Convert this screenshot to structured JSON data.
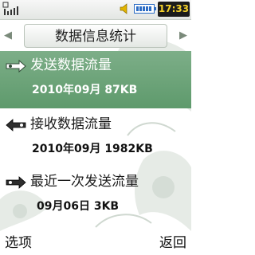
{
  "status_bar": {
    "time": "17:33",
    "icons": [
      "signal-icon",
      "speaker-icon",
      "battery-icon"
    ]
  },
  "header": {
    "title": "数据信息统计",
    "left_arrow": "◀",
    "right_arrow": "▶"
  },
  "list": {
    "items": [
      {
        "label": "发送数据流量",
        "value": "2010年09月 87KB",
        "icon": "upload-data-icon",
        "selected": true
      },
      {
        "label": "接收数据流量",
        "value": "2010年09月 1982KB",
        "icon": "download-data-icon",
        "selected": false
      },
      {
        "label": "最近一次发送流量",
        "value": "09月06日 3KB",
        "icon": "recent-send-icon",
        "selected": false
      }
    ]
  },
  "softkeys": {
    "left": "选项",
    "right": "返回"
  },
  "colors": {
    "selection": "#6ea67a",
    "clock_bg": "#1b1b1b",
    "clock_text": "#f4d12a"
  }
}
